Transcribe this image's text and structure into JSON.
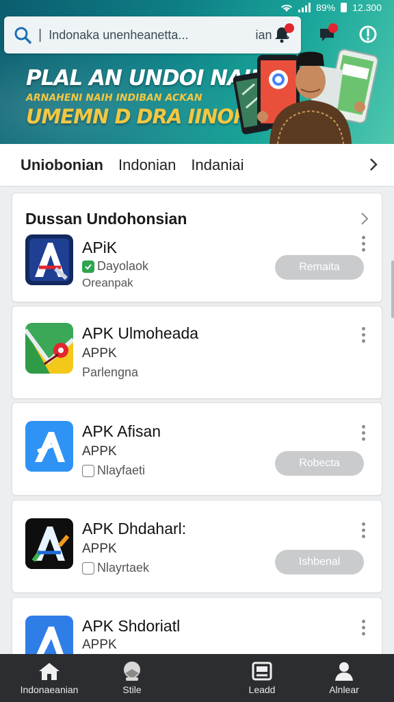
{
  "status_bar": {
    "battery_text": "89%",
    "time": "12.300"
  },
  "search": {
    "query": "Indonaka  unenheanetta...",
    "suffix": "ian",
    "clear_icon": "close-icon"
  },
  "header_icons": [
    "notification-bell-icon",
    "message-icon",
    "alert-icon"
  ],
  "colors": {
    "banner_start": "#0c5c6e",
    "banner_end": "#4fc7ae",
    "accent_yellow": "#f2c744",
    "badge_red": "#e0262e",
    "nav_bg": "#2b2d30"
  },
  "banner": {
    "line1": "PLAL AN UNDOI NAIN",
    "line2": "ARNAHENI NAIH INDIBAN ACKAN",
    "line3": "UMEMN D DRA IINORSAI"
  },
  "tabs": [
    {
      "label": "Uniobonian",
      "active": true
    },
    {
      "label": "Indonian",
      "active": false
    },
    {
      "label": "Indaniai",
      "active": false
    }
  ],
  "section": {
    "title": "Dussan Undohonsian",
    "first_app": {
      "title": "APiK",
      "sub": "Dayolaok",
      "meta": "Oreanpak",
      "button": "Remaita",
      "icon": "app-icon-a-dark"
    }
  },
  "apps": [
    {
      "title": "APK Ulmoheada",
      "sub": "APPK",
      "meta": "Parlengna",
      "button": "",
      "icon": "app-icon-map"
    },
    {
      "title": "APK Afisan",
      "sub": "APPK",
      "meta": "Nlayfaeti",
      "button": "Robecta",
      "icon": "app-icon-a-blue"
    },
    {
      "title": "APK Dhdaharl:",
      "sub": "APPK",
      "meta": "Nlayrtaek",
      "button": "Ishbenal",
      "icon": "app-icon-a-black"
    },
    {
      "title": "APK Shdoriatl",
      "sub": "APPK",
      "meta": "",
      "button": "",
      "icon": "app-icon-a-blue"
    }
  ],
  "bottom_nav": [
    {
      "label": "Indonaeanian",
      "icon": "home-icon"
    },
    {
      "label": "Stile",
      "icon": "games-icon"
    },
    {
      "label": "Leadd",
      "icon": "apps-icon"
    },
    {
      "label": "Alnlear",
      "icon": "person-icon"
    }
  ]
}
